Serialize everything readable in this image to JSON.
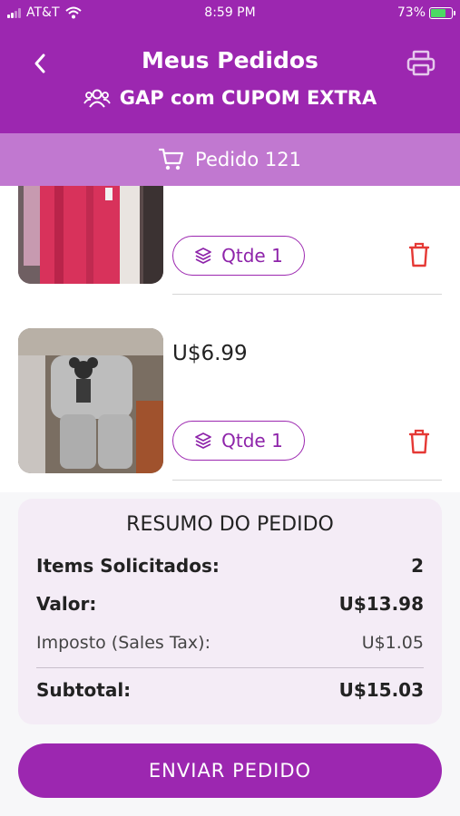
{
  "status_bar": {
    "carrier": "AT&T",
    "time": "8:59 PM",
    "battery": "73%",
    "battery_level": 0.73
  },
  "header": {
    "title": "Meus Pedidos",
    "subtitle": "GAP com CUPOM EXTRA",
    "back_icon": "chevron-left-icon",
    "print_icon": "printer-icon",
    "group_icon": "group-users-icon"
  },
  "order_bar": {
    "label": "Pedido 121",
    "icon": "cart-icon"
  },
  "items": [
    {
      "price": "",
      "qty_label": "Qtde 1",
      "image": "pink-clothing-rack-photo"
    },
    {
      "price": "U$6.99",
      "qty_label": "Qtde 1",
      "image": "gray-mickey-sweatsuit-photo"
    }
  ],
  "summary": {
    "title": "RESUMO DO PEDIDO",
    "items_label": "Items Solicitados:",
    "items_value": "2",
    "valor_label": "Valor:",
    "valor_value": "U$13.98",
    "tax_label": "Imposto (Sales Tax):",
    "tax_value": "U$1.05",
    "subtotal_label": "Subtotal:",
    "subtotal_value": "U$15.03"
  },
  "send_button": "ENVIAR PEDIDO",
  "colors": {
    "primary": "#9c27b0",
    "order_bar": "#c178d0",
    "delete": "#e53935",
    "summary_bg": "#f4ecf6"
  }
}
